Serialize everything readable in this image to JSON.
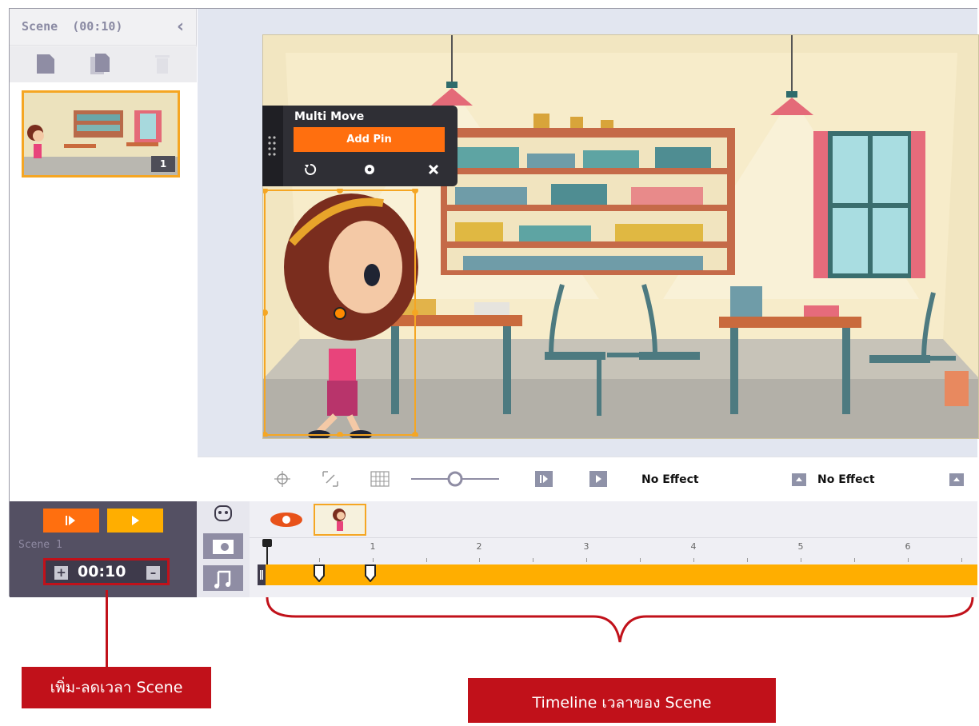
{
  "scene_panel": {
    "title": "Scene",
    "duration": "(00:10)",
    "thumbnail_index": "1"
  },
  "popup": {
    "title": "Multi Move",
    "add_pin_label": "Add Pin"
  },
  "canvas_toolbar": {
    "effect_in": "No Effect",
    "effect_out": "No Effect",
    "zoom_level": 0.2
  },
  "timeline": {
    "scene_label": "Scene 1",
    "time_value": "00:10",
    "ruler_labels": [
      "1",
      "2",
      "3",
      "4",
      "5",
      "6"
    ],
    "colors": {
      "track": "#ffae00",
      "accent": "#ff6f0f",
      "annotation": "#c1111a"
    }
  },
  "annotations": {
    "time_label": "เพิ่ม-ลดเวลา Scene",
    "timeline_label": "Timeline เวลาของ Scene"
  }
}
